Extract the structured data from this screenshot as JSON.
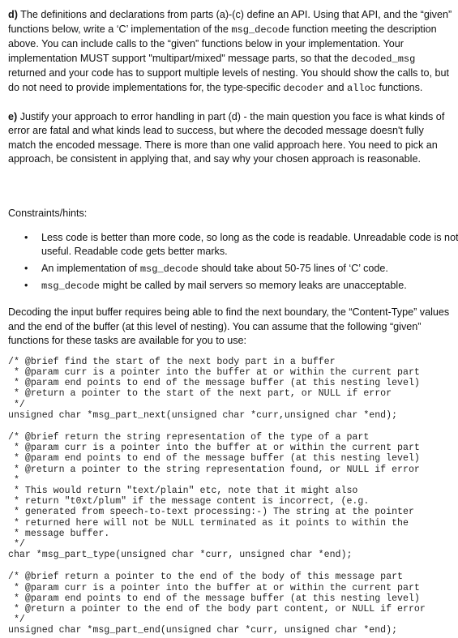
{
  "part_d": {
    "label": "d)",
    "text_1": " The definitions and declarations from parts (a)-(c) define an API.  Using that API, and the “given” functions below, write a ‘C’ implementation of the ",
    "code_1": "msg_decode",
    "text_2": " function meeting the description above. You can include calls to the “given” functions below in your implementation.  Your implementation MUST support \"multipart/mixed\" message parts, so that the ",
    "code_2": "decoded_msg",
    "text_3": " returned and your code has to support multiple levels of nesting. You should show the calls to, but do not need to provide implementations for, the type-specific ",
    "code_3": "decoder",
    "text_4": " and ",
    "code_4": "alloc",
    "text_5": " functions."
  },
  "part_e": {
    "label": "e)",
    "text": " Justify your approach to error handling in part (d) - the main question you face is what kinds of error are fatal and what kinds lead to success, but where the decoded message doesn't fully match the encoded message.  There is more than one valid approach here. You need to pick an approach, be consistent in applying that, and say why your chosen approach is reasonable."
  },
  "constraints_heading": "Constraints/hints:",
  "hints": {
    "bullet": "•",
    "item1": "Less code is better than more code, so long as the code is readable. Unreadable code is not useful. Readable code gets better marks.",
    "item2_pre": "An implementation of ",
    "item2_code": "msg_decode",
    "item2_post": " should take about 50-75 lines of ‘C’ code.",
    "item3_code": "msg_decode",
    "item3_post": "  might be called by mail servers so memory leaks are unacceptable."
  },
  "decoding_paragraph": "Decoding the input buffer requires being able to find the next boundary, the “Content-Type” values and the end of the buffer (at this level of nesting). You can assume that the following “given” functions for these tasks are available for you to use:",
  "code_blocks": [
    "/* @brief find the start of the next body part in a buffer\n * @param curr is a pointer into the buffer at or within the current part\n * @param end points to end of the message buffer (at this nesting level)\n * @return a pointer to the start of the next part, or NULL if error\n */\nunsigned char *msg_part_next(unsigned char *curr,unsigned char *end);",
    "/* @brief return the string representation of the type of a part\n * @param curr is a pointer into the buffer at or within the current part\n * @param end points to end of the message buffer (at this nesting level)\n * @return a pointer to the string representation found, or NULL if error\n *\n * This would return \"text/plain\" etc, note that it might also\n * return \"t0xt/plum\" if the message content is incorrect, (e.g.\n * generated from speech-to-text processing:-) The string at the pointer\n * returned here will not be NULL terminated as it points to within the\n * message buffer.\n */\nchar *msg_part_type(unsigned char *curr, unsigned char *end);",
    "/* @brief return a pointer to the end of the body of this message part\n * @param curr is a pointer into the buffer at or within the current part\n * @param end points to end of the message buffer (at this nesting level)\n * @return a pointer to the end of the body part content, or NULL if error\n */\nunsigned char *msg_part_end(unsigned char *curr, unsigned char *end);"
  ]
}
